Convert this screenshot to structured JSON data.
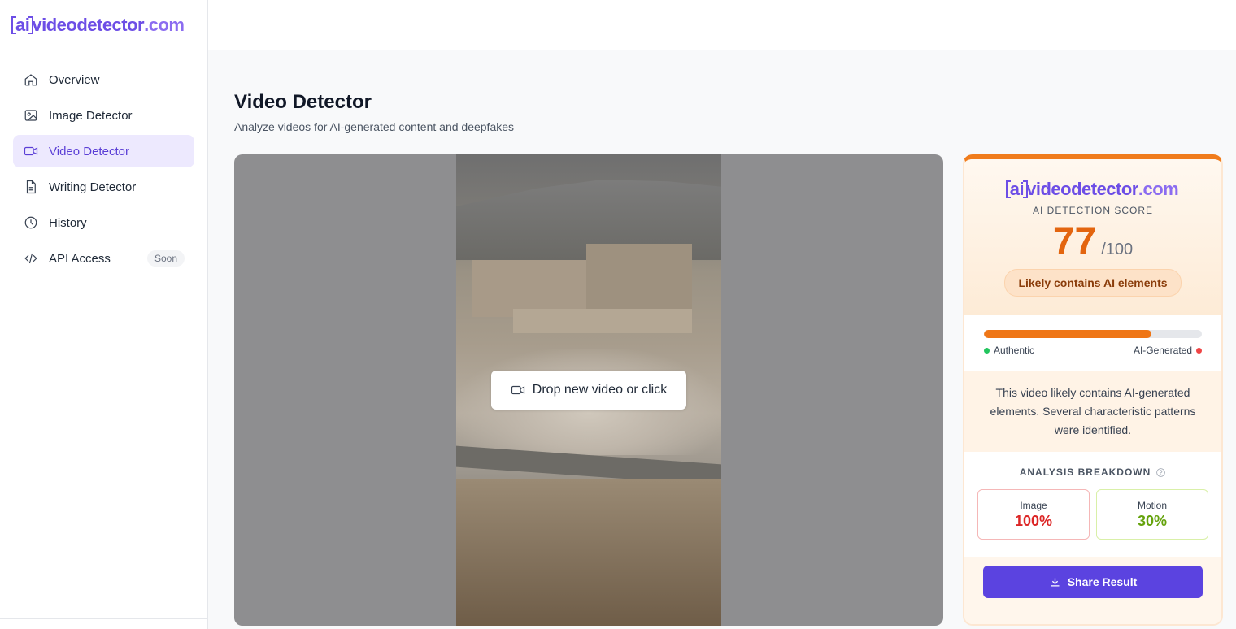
{
  "sidebar": {
    "logo": {
      "ai": "ai",
      "brand": "videodetector",
      "tld": ".com"
    },
    "items": [
      {
        "label": "Overview",
        "icon": "home-icon"
      },
      {
        "label": "Image Detector",
        "icon": "image-icon"
      },
      {
        "label": "Video Detector",
        "icon": "video-icon",
        "active": true
      },
      {
        "label": "Writing Detector",
        "icon": "document-icon"
      },
      {
        "label": "History",
        "icon": "clock-icon"
      },
      {
        "label": "API Access",
        "icon": "code-icon",
        "badge": "Soon"
      }
    ]
  },
  "main": {
    "title": "Video Detector",
    "subtitle": "Analyze videos for AI-generated content and deepfakes",
    "drop_label": "Drop new video or click"
  },
  "result": {
    "logo": {
      "ai": "ai",
      "brand": "videodetector",
      "tld": ".com"
    },
    "score_label": "AI DETECTION SCORE",
    "score": "77",
    "score_max": "/100",
    "score_fraction": 0.77,
    "verdict": "Likely contains AI elements",
    "legend_left": "Authentic",
    "legend_right": "AI-Generated",
    "description": "This video likely contains AI-generated elements. Several characteristic patterns were identified.",
    "breakdown_title": "ANALYSIS BREAKDOWN",
    "breakdown": [
      {
        "name": "Image",
        "value": "100%"
      },
      {
        "name": "Motion",
        "value": "30%"
      }
    ],
    "share_label": "Share Result"
  },
  "colors": {
    "accent": "#5b43e0",
    "score": "#e3650f",
    "image_score": "#dc2626",
    "motion_score": "#65a30d"
  }
}
